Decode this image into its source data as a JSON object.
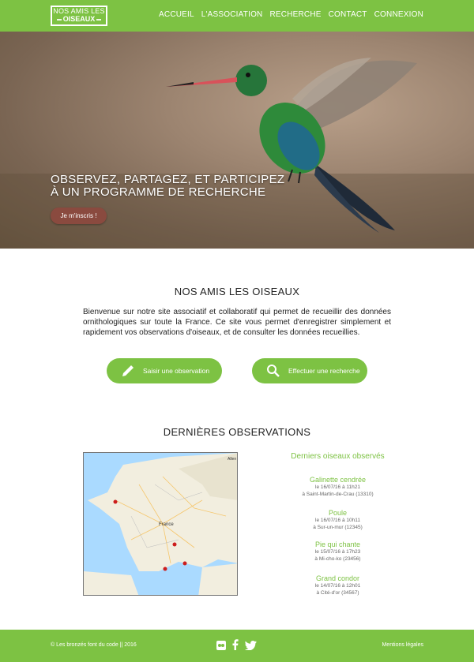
{
  "header": {
    "logo_line1": "NOS AMIS LES",
    "logo_line2": "OISEAUX",
    "nav": [
      "ACCUEIL",
      "L'ASSOCIATION",
      "RECHERCHE",
      "CONTACT",
      "CONNEXION"
    ]
  },
  "hero": {
    "title_line1": "OBSERVEZ, PARTAGEZ, ET PARTICIPEZ",
    "title_line2": "À UN PROGRAMME DE RECHERCHE",
    "cta": "Je m'inscris !"
  },
  "intro": {
    "title": "NOS AMIS LES OISEAUX",
    "text": "Bienvenue sur notre site associatif et collaboratif qui permet de recueillir des données ornithologiques sur toute la France. Ce site vous permet d'enregistrer simplement et rapidement vos observations d'oiseaux, et de consulter les données recueillies."
  },
  "actions": {
    "observe": "Saisir une observation",
    "search": "Effectuer une recherche"
  },
  "observations": {
    "title": "DERNIÈRES OBSERVATIONS",
    "map_labels": {
      "country": "France",
      "region": "Allen"
    },
    "side_title": "Derniers oiseaux observés",
    "items": [
      {
        "name": "Galinette cendrée",
        "date": "le 16/07/16 à 11h21",
        "place": "à Saint-Martin-de-Crau (13310)"
      },
      {
        "name": "Poule",
        "date": "le 16/07/16 à 10h11",
        "place": "à Sur-un-mur (12345)"
      },
      {
        "name": "Pie qui chante",
        "date": "le 15/07/16 à 17h23",
        "place": "à Mi-cho-ko (23456)"
      },
      {
        "name": "Grand condor",
        "date": "le 14/07/16 à 12h01",
        "place": "à Cité-d'or (34567)"
      }
    ]
  },
  "footer": {
    "copyright": "© Les bronzés font du code || 2016",
    "legal": "Mentions légales",
    "social": [
      "flickr-icon",
      "facebook-icon",
      "twitter-icon"
    ]
  },
  "colors": {
    "brand": "#7dc243",
    "hero_button": "#8a4a3f"
  }
}
